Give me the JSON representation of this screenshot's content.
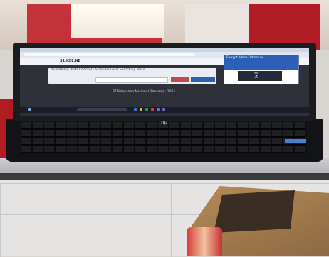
{
  "screen": {
    "site_logo": "S1.KEL.NE",
    "card_title": "Availability Posts Checker · Scrabble Local Searching Place",
    "dialog_title": "Encrypt Adobe Options no",
    "footer_text": "PT Pelayanan Nasional (Persero) · 2021"
  },
  "laptop": {
    "brand_logo": "hp"
  },
  "colors": {
    "dialog_header": "#2b5fb8",
    "search_button": "#2f5fb4",
    "shelf_red": "#c0202a"
  }
}
